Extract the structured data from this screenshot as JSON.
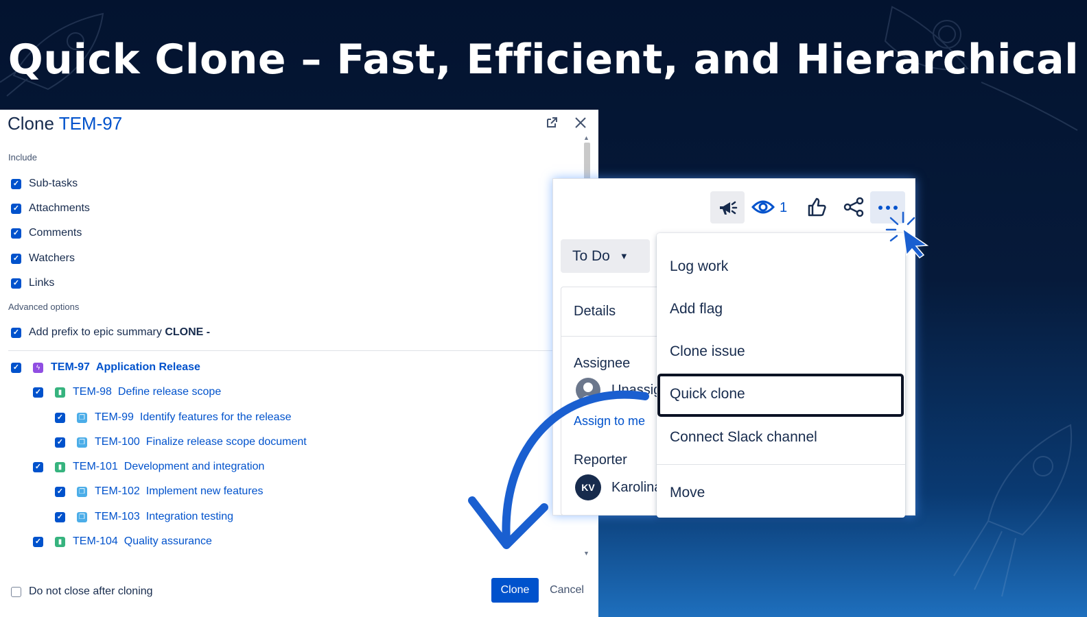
{
  "headline": "Quick Clone – Fast, Efficient, and Hierarchical",
  "dialog": {
    "title_prefix": "Clone",
    "title_key": "TEM-97",
    "include_label": "Include",
    "include_options": [
      "Sub-tasks",
      "Attachments",
      "Comments",
      "Watchers",
      "Links"
    ],
    "advanced_label": "Advanced options",
    "prefix_option_text": "Add prefix to epic summary",
    "prefix_value": "CLONE -",
    "tree": [
      {
        "key": "TEM-97",
        "summary": "Application Release",
        "type": "epic",
        "level": 0
      },
      {
        "key": "TEM-98",
        "summary": "Define release scope",
        "type": "story",
        "level": 1
      },
      {
        "key": "TEM-99",
        "summary": "Identify features for the release",
        "type": "subtask",
        "level": 2
      },
      {
        "key": "TEM-100",
        "summary": "Finalize release scope document",
        "type": "subtask",
        "level": 2
      },
      {
        "key": "TEM-101",
        "summary": "Development and integration",
        "type": "story",
        "level": 1
      },
      {
        "key": "TEM-102",
        "summary": "Implement new features",
        "type": "subtask",
        "level": 2
      },
      {
        "key": "TEM-103",
        "summary": "Integration testing",
        "type": "subtask",
        "level": 2
      },
      {
        "key": "TEM-104",
        "summary": "Quality assurance",
        "type": "story",
        "level": 1
      }
    ],
    "do_not_close_label": "Do not close after cloning",
    "clone_button": "Clone",
    "cancel_button": "Cancel"
  },
  "issue_panel": {
    "watch_count": "1",
    "status": "To Do",
    "details_heading": "Details",
    "assignee_label": "Assignee",
    "assignee_value": "Unassigned",
    "assign_to_me": "Assign to me",
    "reporter_label": "Reporter",
    "reporter_initials": "KV",
    "reporter_name": "Karolina"
  },
  "menu": {
    "items": [
      "Log work",
      "Add flag",
      "Clone issue",
      "Quick clone",
      "Connect Slack channel",
      "Move"
    ],
    "highlighted": "Quick clone"
  },
  "colors": {
    "accent": "#0052cc",
    "background_dark": "#03132f",
    "background_light": "#1e6fbd"
  }
}
